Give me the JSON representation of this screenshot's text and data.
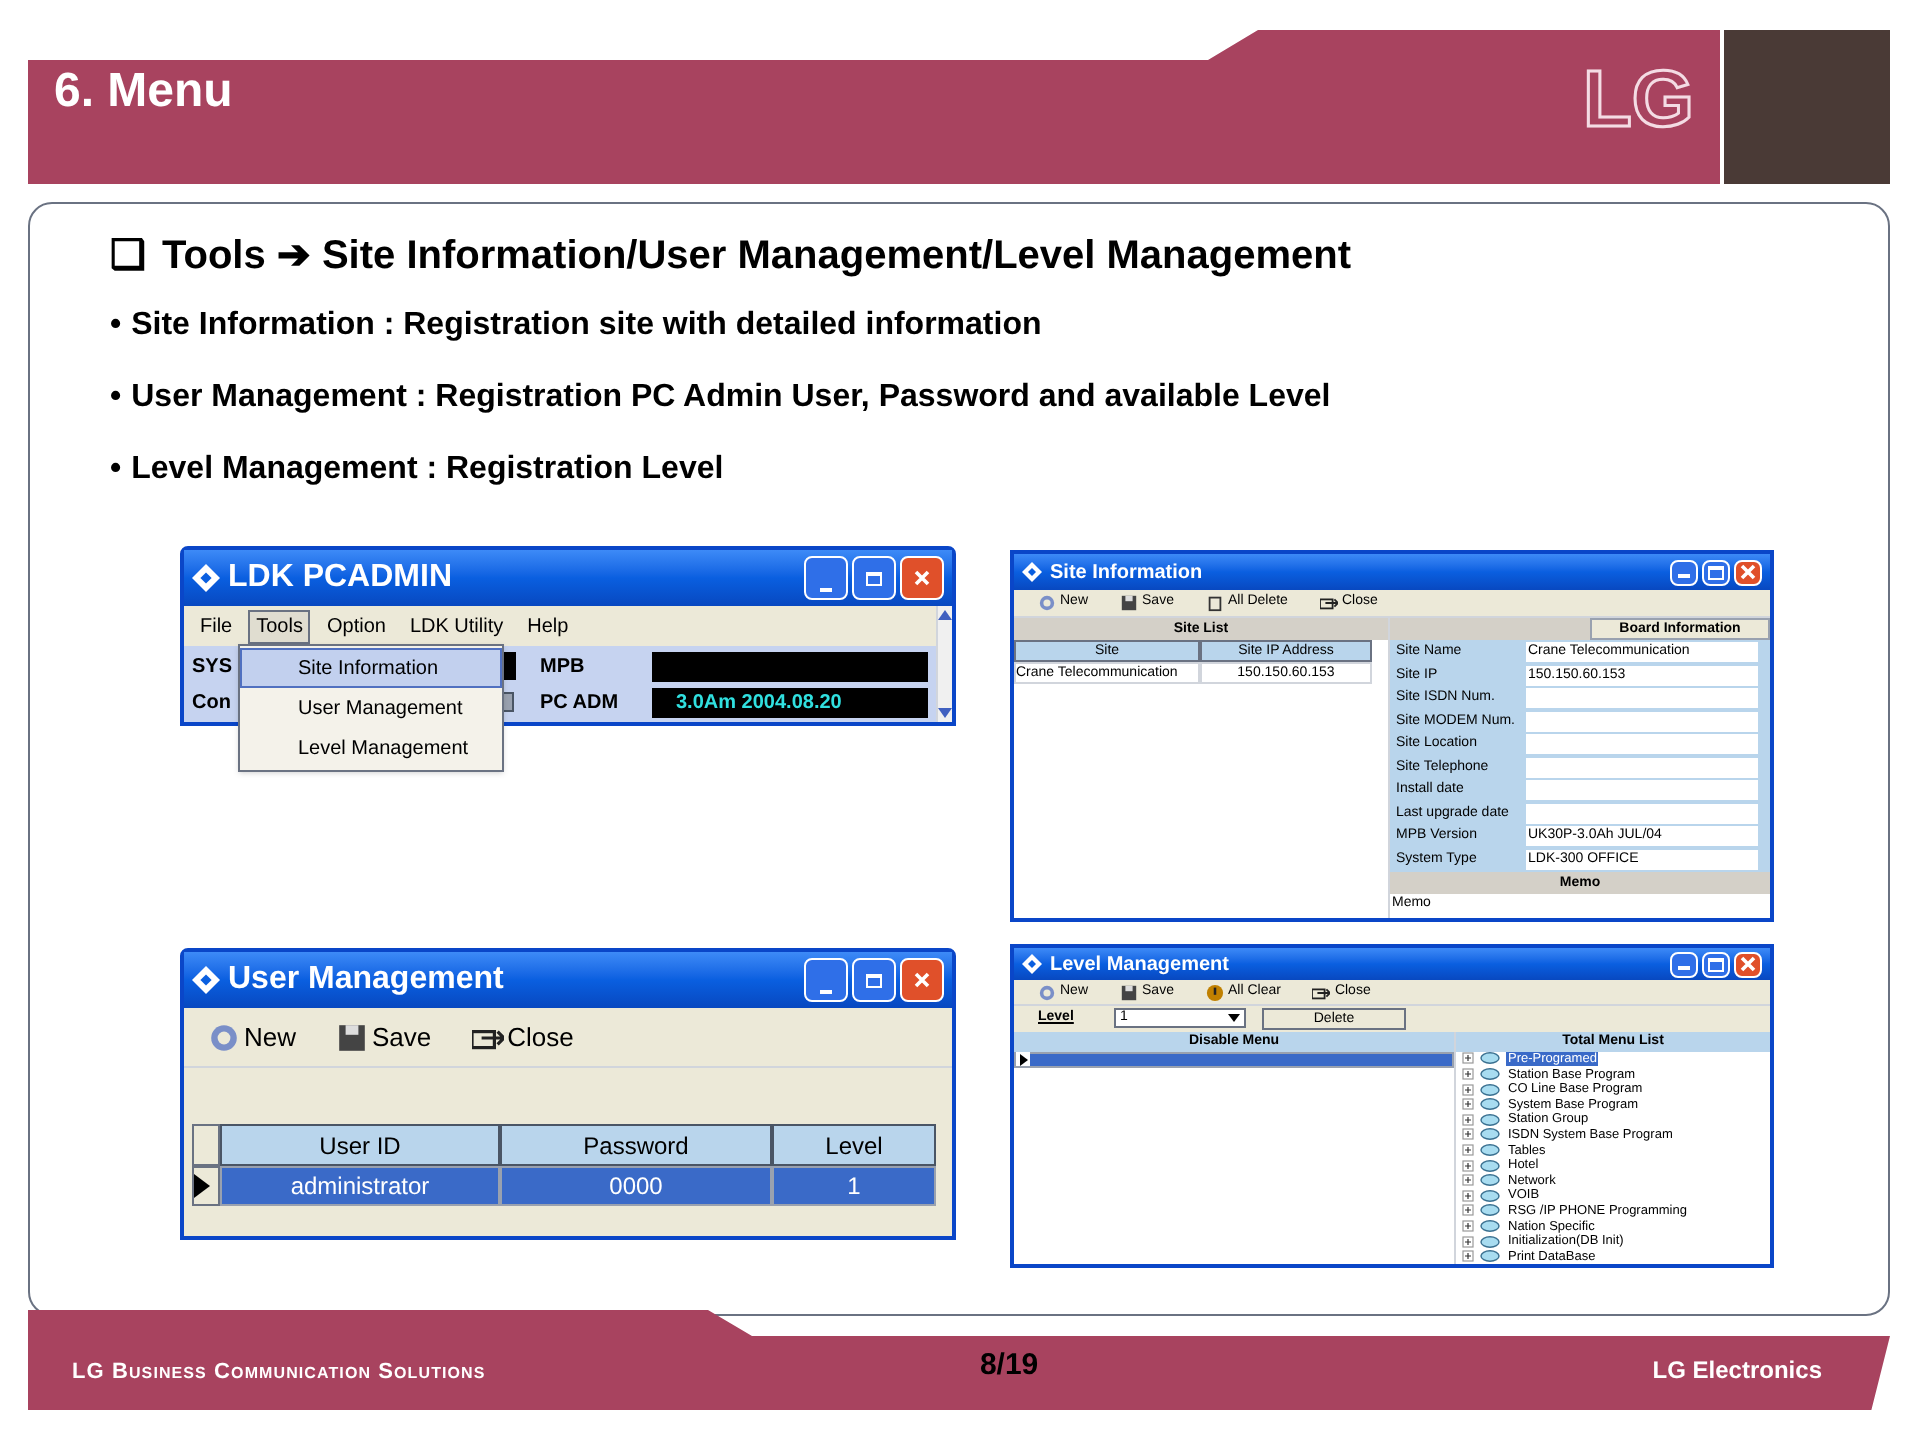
{
  "header": {
    "title": "6. Menu",
    "logo": "LG"
  },
  "content": {
    "heading": {
      "marker": "❑",
      "text": "Tools ➔ Site Information/User Management/Level Management"
    },
    "bullets": [
      {
        "marker": "•",
        "text": "Site Information : Registration site with detailed information"
      },
      {
        "marker": "•",
        "text": "User Management : Registration PC Admin User, Password and available Level"
      },
      {
        "marker": "•",
        "text": "Level Management : Registration Level"
      }
    ]
  },
  "windows": [
    {
      "kind": "pcadmin",
      "title": "LDK PCADMIN",
      "menu": [
        {
          "label": "File",
          "selected": false
        },
        {
          "label": "Tools",
          "selected": true
        },
        {
          "label": "Option",
          "selected": false
        },
        {
          "label": "LDK Utility",
          "selected": false
        },
        {
          "label": "Help",
          "selected": false
        }
      ],
      "dropdown": [
        {
          "label": "Site Information",
          "selected": true
        },
        {
          "label": "User Management",
          "selected": false
        },
        {
          "label": "Level Management",
          "selected": false
        }
      ],
      "rows": [
        {
          "label": "SYS",
          "field_label": "MPB"
        },
        {
          "label": "Con",
          "field_label": "PC ADM",
          "value": "3.0Am 2004.08.20"
        }
      ]
    },
    {
      "kind": "site_info",
      "title": "Site Information",
      "toolbar": [
        "New",
        "Save",
        "All Delete",
        "Close"
      ],
      "list_title": "Site List",
      "columns": [
        "Site",
        "Site IP Address"
      ],
      "rows": [
        [
          "Crane Telecommunication",
          "150.150.60.153"
        ]
      ],
      "board_title": "Board Information",
      "fields": [
        {
          "label": "Site Name",
          "value": "Crane Telecommunication"
        },
        {
          "label": "Site IP",
          "value": "150.150.60.153"
        },
        {
          "label": "Site ISDN Num."
        },
        {
          "label": "Site MODEM Num."
        },
        {
          "label": "Site Location"
        },
        {
          "label": "Site Telephone"
        },
        {
          "label": "Install date"
        },
        {
          "label": "Last upgrade date"
        },
        {
          "label": "MPB Version",
          "value": "UK30P-3.0Ah JUL/04"
        },
        {
          "label": "System Type",
          "value": "LDK-300 OFFICE"
        }
      ],
      "memo_title": "Memo",
      "memo": "Memo"
    },
    {
      "kind": "user_mgmt",
      "title": "User Management",
      "toolbar": [
        "New",
        "Save",
        "Close"
      ],
      "columns": [
        "User ID",
        "Password",
        "Level"
      ],
      "rows": [
        {
          "cells": [
            "administrator",
            "0000",
            "1"
          ],
          "selected": true
        }
      ]
    },
    {
      "kind": "level_mgmt",
      "title": "Level Management",
      "toolbar": [
        "New",
        "Save",
        "All Clear",
        "Close"
      ],
      "level_label": "Level",
      "level_value": "1",
      "delete": "Delete",
      "left_title": "Disable Menu",
      "right_title": "Total Menu List",
      "tree": [
        {
          "label": "Pre-Programed",
          "selected": true
        },
        {
          "label": "Station Base Program",
          "selected": false
        },
        {
          "label": "CO Line Base Program",
          "selected": false
        },
        {
          "label": "System Base Program",
          "selected": false
        },
        {
          "label": "Station Group",
          "selected": false
        },
        {
          "label": "ISDN System Base Program",
          "selected": false
        },
        {
          "label": "Tables",
          "selected": false
        },
        {
          "label": "Hotel",
          "selected": false
        },
        {
          "label": "Network",
          "selected": false
        },
        {
          "label": "VOIB",
          "selected": false
        },
        {
          "label": "RSG /IP PHONE Programming",
          "selected": false
        },
        {
          "label": "Nation Specific",
          "selected": false
        },
        {
          "label": "Initialization(DB Init)",
          "selected": false
        },
        {
          "label": "Print DataBase",
          "selected": false
        }
      ]
    }
  ],
  "footer": {
    "left": "LG Business Communication Solutions",
    "page": "8/19",
    "right": "LG Electronics"
  }
}
